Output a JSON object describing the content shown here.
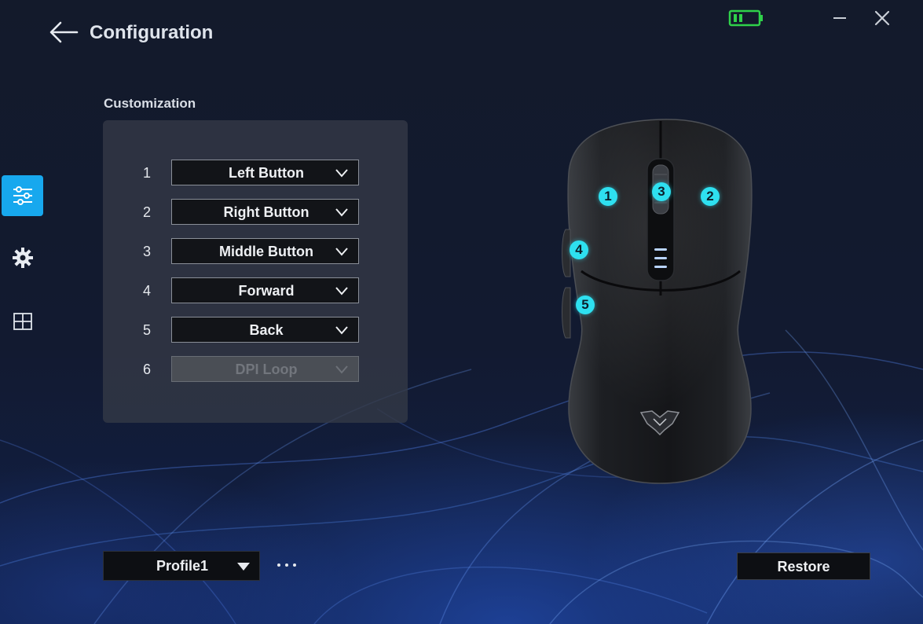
{
  "header": {
    "title": "Configuration",
    "back_icon": "arrow-left-icon",
    "battery_icon": "battery-icon",
    "battery_color": "#2fd14a",
    "minimize_icon": "minimize-icon",
    "close_icon": "close-icon"
  },
  "sidebar": {
    "accent": "#17a8ee",
    "items": [
      {
        "icon": "sliders-icon",
        "active": true
      },
      {
        "icon": "gear-icon",
        "active": false
      },
      {
        "icon": "grid-icon",
        "active": false
      }
    ]
  },
  "customization": {
    "label": "Customization",
    "buttons": [
      {
        "number": "1",
        "value": "Left Button",
        "disabled": false
      },
      {
        "number": "2",
        "value": "Right Button",
        "disabled": false
      },
      {
        "number": "3",
        "value": "Middle Button",
        "disabled": false
      },
      {
        "number": "4",
        "value": "Forward",
        "disabled": false
      },
      {
        "number": "5",
        "value": "Back",
        "disabled": false
      },
      {
        "number": "6",
        "value": "DPI Loop",
        "disabled": true
      }
    ]
  },
  "mouse": {
    "badges": [
      "1",
      "2",
      "3",
      "4",
      "5"
    ],
    "badge_color": "#2ee0f0",
    "logo_icon": "brand-logo-icon"
  },
  "footer": {
    "profile": "Profile1",
    "more_icon": "more-dots-icon",
    "restore_label": "Restore"
  }
}
